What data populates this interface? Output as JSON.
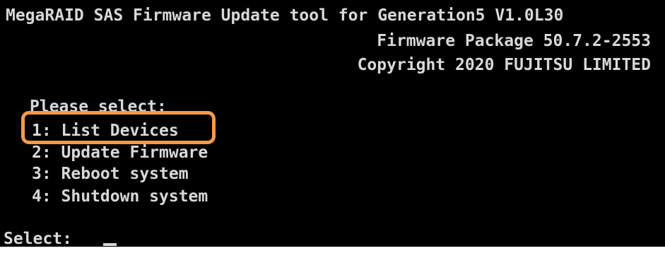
{
  "console": {
    "title_line": "MegaRAID SAS Firmware Update tool for Generation5 V1.0L30",
    "package_line": "Firmware Package 50.7.2-2553",
    "copyright_line": "Copyright 2020 FUJITSU LIMITED",
    "prompt_header": "Please select:",
    "menu": [
      {
        "label": "1: List Devices"
      },
      {
        "label": "2: Update Firmware"
      },
      {
        "label": "3: Reboot system"
      },
      {
        "label": "4: Shutdown system"
      }
    ],
    "select_prompt": "Select:",
    "cursor": "_"
  },
  "colors": {
    "background": "#000000",
    "text": "#d8d8d8",
    "highlight": "#f39a4b"
  },
  "highlighted_item_index": 0
}
